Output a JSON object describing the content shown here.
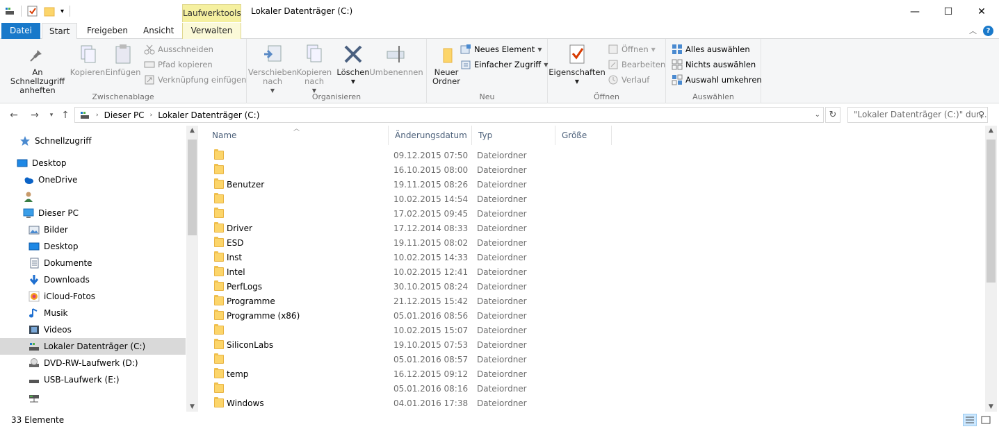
{
  "window": {
    "title": "Lokaler Datenträger (C:)",
    "context_tab_header": "Laufwerktools",
    "minimize": "—",
    "maximize": "☐",
    "close": "✕"
  },
  "tabs": {
    "file": "Datei",
    "start": "Start",
    "share": "Freigeben",
    "view": "Ansicht",
    "manage": "Verwalten"
  },
  "ribbon": {
    "clipboard": {
      "label": "Zwischenablage",
      "pin": "An Schnellzugriff anheften",
      "copy": "Kopieren",
      "paste": "Einfügen",
      "cut": "Ausschneiden",
      "copy_path": "Pfad kopieren",
      "paste_shortcut": "Verknüpfung einfügen"
    },
    "organize": {
      "label": "Organisieren",
      "move_to": "Verschieben nach",
      "copy_to": "Kopieren nach",
      "delete": "Löschen",
      "rename": "Umbenennen"
    },
    "new": {
      "label": "Neu",
      "new_folder": "Neuer Ordner",
      "new_item": "Neues Element",
      "easy_access": "Einfacher Zugriff"
    },
    "open": {
      "label": "Öffnen",
      "properties": "Eigenschaften",
      "open": "Öffnen",
      "edit": "Bearbeiten",
      "history": "Verlauf"
    },
    "select": {
      "label": "Auswählen",
      "select_all": "Alles auswählen",
      "select_none": "Nichts auswählen",
      "invert": "Auswahl umkehren"
    }
  },
  "address": {
    "crumbs": [
      "Dieser PC",
      "Lokaler Datenträger (C:)"
    ],
    "search_placeholder": "\"Lokaler Datenträger (C:)\" dur..."
  },
  "nav": [
    {
      "label": "Schnellzugriff",
      "icon": "star-icon"
    },
    {
      "label": "Desktop",
      "icon": "desktop-icon"
    },
    {
      "label": "OneDrive",
      "icon": "cloud-icon"
    },
    {
      "label": "",
      "icon": "user-icon"
    },
    {
      "label": "Dieser PC",
      "icon": "computer-icon"
    },
    {
      "label": "Bilder",
      "icon": "pictures-icon"
    },
    {
      "label": "Desktop",
      "icon": "desktop-icon"
    },
    {
      "label": "Dokumente",
      "icon": "documents-icon"
    },
    {
      "label": "Downloads",
      "icon": "download-icon"
    },
    {
      "label": "iCloud-Fotos",
      "icon": "icloud-photos-icon"
    },
    {
      "label": "Musik",
      "icon": "music-icon"
    },
    {
      "label": "Videos",
      "icon": "videos-icon"
    },
    {
      "label": "Lokaler Datenträger (C:)",
      "icon": "drive-icon"
    },
    {
      "label": "DVD-RW-Laufwerk (D:)",
      "icon": "dvd-icon"
    },
    {
      "label": "USB-Laufwerk (E:)",
      "icon": "usb-drive-icon"
    },
    {
      "label": "",
      "icon": "network-drive-icon"
    }
  ],
  "columns": {
    "name": "Name",
    "date": "Änderungsdatum",
    "type": "Typ",
    "size": "Größe"
  },
  "files": [
    {
      "name": "",
      "date": "09.12.2015 07:50",
      "type": "Dateiordner"
    },
    {
      "name": "",
      "date": "16.10.2015 08:00",
      "type": "Dateiordner"
    },
    {
      "name": "Benutzer",
      "date": "19.11.2015 08:26",
      "type": "Dateiordner"
    },
    {
      "name": "",
      "date": "10.02.2015 14:54",
      "type": "Dateiordner"
    },
    {
      "name": "",
      "date": "17.02.2015 09:45",
      "type": "Dateiordner"
    },
    {
      "name": "Driver",
      "date": "17.12.2014 08:33",
      "type": "Dateiordner"
    },
    {
      "name": "ESD",
      "date": "19.11.2015 08:02",
      "type": "Dateiordner"
    },
    {
      "name": "Inst",
      "date": "10.02.2015 14:33",
      "type": "Dateiordner"
    },
    {
      "name": "Intel",
      "date": "10.02.2015 12:41",
      "type": "Dateiordner"
    },
    {
      "name": "PerfLogs",
      "date": "30.10.2015 08:24",
      "type": "Dateiordner"
    },
    {
      "name": "Programme",
      "date": "21.12.2015 15:42",
      "type": "Dateiordner"
    },
    {
      "name": "Programme (x86)",
      "date": "05.01.2016 08:56",
      "type": "Dateiordner"
    },
    {
      "name": "",
      "date": "10.02.2015 15:07",
      "type": "Dateiordner"
    },
    {
      "name": "SiliconLabs",
      "date": "19.10.2015 07:53",
      "type": "Dateiordner"
    },
    {
      "name": "",
      "date": "05.01.2016 08:57",
      "type": "Dateiordner"
    },
    {
      "name": "temp",
      "date": "16.12.2015 09:12",
      "type": "Dateiordner"
    },
    {
      "name": "",
      "date": "05.01.2016 08:16",
      "type": "Dateiordner"
    },
    {
      "name": "Windows",
      "date": "04.01.2016 17:38",
      "type": "Dateiordner"
    }
  ],
  "status": {
    "count": "33 Elemente"
  },
  "colors": {
    "file_tab": "#1979ca",
    "selection": "#d9d9d9",
    "context_tab": "#f5f0a0",
    "folder": "#fcd56a"
  }
}
